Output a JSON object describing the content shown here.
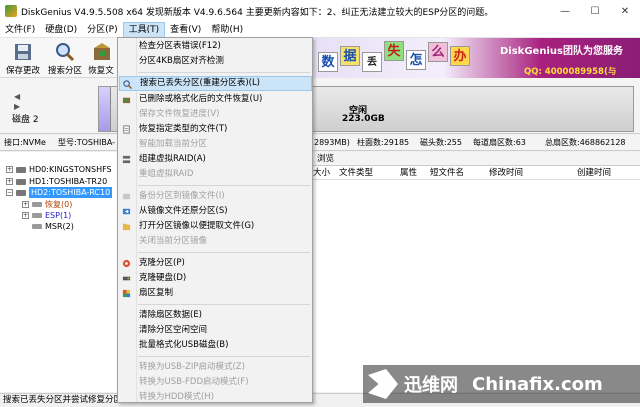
{
  "window": {
    "title": "DiskGenius V4.9.5.508 x64   发现新版本 V4.9.6.564 主要更新内容如下：2、纠正无法建立较大的ESP分区的问题。",
    "minimize": "—",
    "maximize": "☐",
    "close": "✕"
  },
  "menubar": {
    "items": [
      "文件(F)",
      "硬盘(D)",
      "分区(P)",
      "工具(T)",
      "查看(V)",
      "帮助(H)"
    ]
  },
  "toolbar": {
    "save_label": "保存更改",
    "search_label": "搜索分区",
    "recover_label": "恢复文"
  },
  "banner": {
    "tiles": [
      "数",
      "据",
      "丢",
      "失",
      "怎",
      "么",
      "办"
    ],
    "slogan": "DiskGenius团队为您服务",
    "qq": "QQ: 4000089958(与"
  },
  "diskbar": {
    "disk_label": "磁盘 2",
    "free_name": "空闲",
    "free_size": "223.0GB"
  },
  "infobar": {
    "interface": "接口:NVMe",
    "model": "型号:TOSHIBA-",
    "capacity": "2893MB)",
    "cylinders": "柱面数:29185",
    "heads": "磁头数:255",
    "sectors_per_track": "每道扇区数:63",
    "total_sectors": "总扇区数:468862128"
  },
  "tree": {
    "hd0": "HD0:KINGSTONSHFS",
    "hd1": "HD1:TOSHIBA-TR20",
    "hd2": "HD2:TOSHIBA-RC10",
    "part_recover": "恢复(0)",
    "part_esp": "ESP(1)",
    "part_msr": "MSR(2)"
  },
  "right": {
    "tab_label": "浏览",
    "columns": [
      "大小",
      "文件类型",
      "属性",
      "短文件名",
      "修改时间",
      "创建时间"
    ]
  },
  "statusbar": {
    "text": "搜索已丢失分区并尝试修复分区表"
  },
  "watermark": {
    "cn": "迅维网",
    "en": "Chinafix.com"
  },
  "tools_menu": {
    "items": [
      {
        "label": "检查分区表错误(F12)",
        "disabled": false
      },
      {
        "label": "分区4KB扇区对齐检测",
        "disabled": false
      },
      {
        "label": "搜索已丢失分区(重建分区表)(L)",
        "disabled": false
      },
      {
        "label": "已删除或格式化后的文件恢复(U)",
        "disabled": false
      },
      {
        "label": "保存文件恢复进度(V)",
        "disabled": true
      },
      {
        "label": "恢复指定类型的文件(T)",
        "disabled": false
      },
      {
        "label": "智能加载当前分区",
        "disabled": true
      },
      {
        "label": "组建虚拟RAID(A)",
        "disabled": false
      },
      {
        "label": "重组虚拟RAID",
        "disabled": true
      },
      {
        "label": "备份分区到镜像文件(I)",
        "disabled": true
      },
      {
        "label": "从镜像文件还原分区(S)",
        "disabled": false
      },
      {
        "label": "打开分区镜像以便提取文件(G)",
        "disabled": false
      },
      {
        "label": "关闭当前分区镜像",
        "disabled": true
      },
      {
        "label": "克隆分区(P)",
        "disabled": false
      },
      {
        "label": "克隆硬盘(D)",
        "disabled": false
      },
      {
        "label": "扇区复制",
        "disabled": false
      },
      {
        "label": "清除扇区数据(E)",
        "disabled": false
      },
      {
        "label": "清除分区空闲空间",
        "disabled": false
      },
      {
        "label": "批量格式化USB磁盘(B)",
        "disabled": false
      },
      {
        "label": "转换为USB-ZIP启动模式(Z)",
        "disabled": true
      },
      {
        "label": "转换为USB-FDD启动模式(F)",
        "disabled": true
      },
      {
        "label": "转换为HDD模式(H)",
        "disabled": true
      }
    ]
  }
}
